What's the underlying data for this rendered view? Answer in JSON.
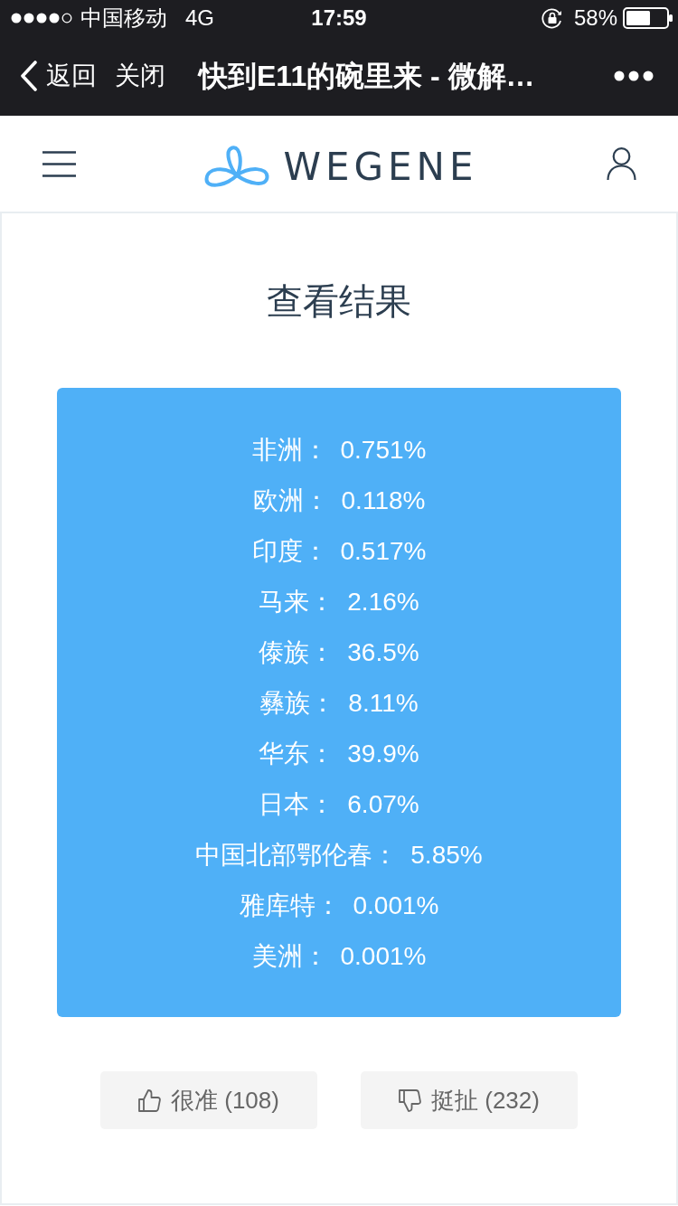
{
  "status_bar": {
    "carrier": "中国移动",
    "network": "4G",
    "time": "17:59",
    "battery": "58%"
  },
  "nav_bar": {
    "back": "返回",
    "close": "关闭",
    "title": "快到E11的碗里来 - 微解…"
  },
  "header": {
    "logo_text": "WEGENE"
  },
  "page": {
    "title": "查看结果",
    "results": [
      {
        "label": "非洲：",
        "value": "0.751%"
      },
      {
        "label": "欧洲：",
        "value": "0.118%"
      },
      {
        "label": "印度：",
        "value": "0.517%"
      },
      {
        "label": "马来：",
        "value": "2.16%"
      },
      {
        "label": "傣族：",
        "value": "36.5%"
      },
      {
        "label": "彝族：",
        "value": "8.11%"
      },
      {
        "label": "华东：",
        "value": "39.9%"
      },
      {
        "label": "日本：",
        "value": "6.07%"
      },
      {
        "label": "中国北部鄂伦春：",
        "value": "5.85%"
      },
      {
        "label": "雅库特：",
        "value": "0.001%"
      },
      {
        "label": "美洲：",
        "value": "0.001%"
      }
    ],
    "feedback": [
      {
        "kind": "up",
        "label": "很准 (108)"
      },
      {
        "kind": "down",
        "label": "挺扯 (232)"
      }
    ]
  }
}
